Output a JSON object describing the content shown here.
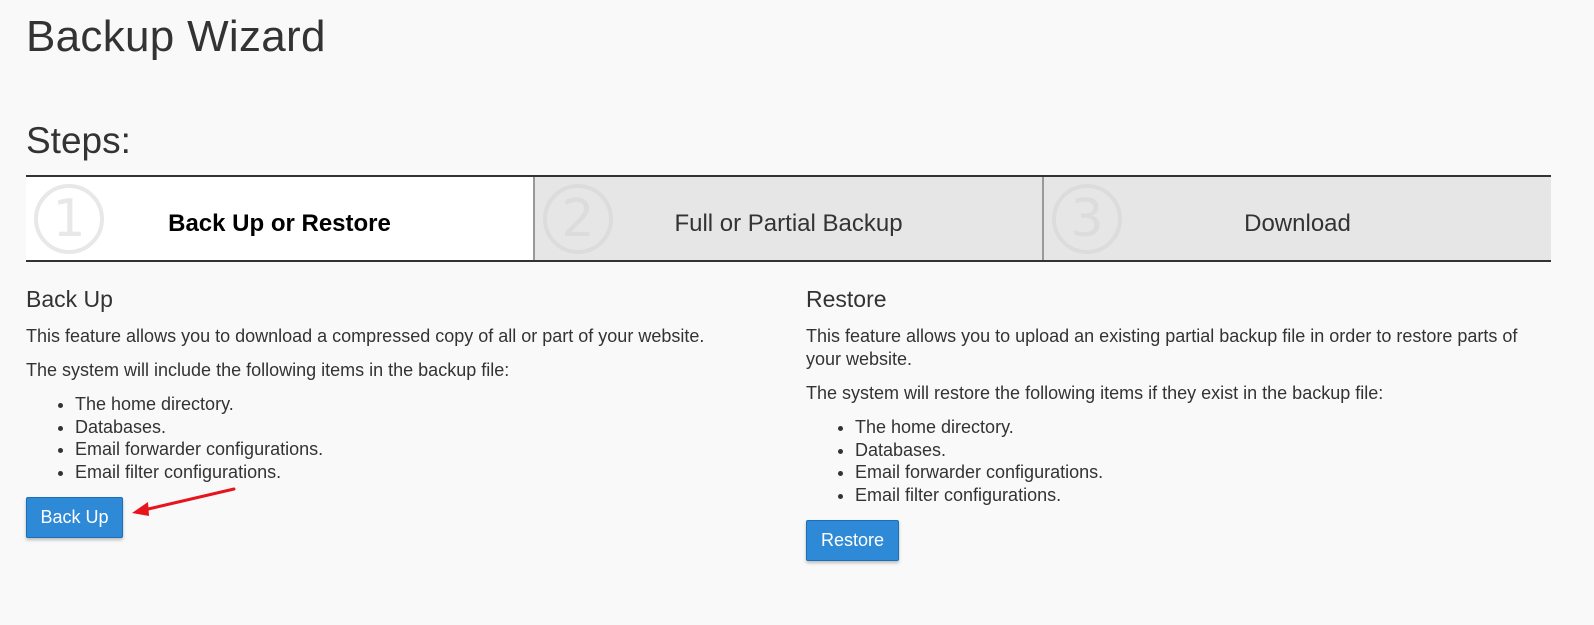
{
  "title": "Backup Wizard",
  "steps_heading": "Steps:",
  "steps": [
    {
      "number": "1",
      "label": "Back Up or Restore",
      "active": true
    },
    {
      "number": "2",
      "label": "Full or Partial Backup",
      "active": false
    },
    {
      "number": "3",
      "label": "Download",
      "active": false
    }
  ],
  "backup": {
    "heading": "Back Up",
    "description": "This feature allows you to download a compressed copy of all or part of your website.",
    "items_intro": "The system will include the following items in the backup file:",
    "items": [
      "The home directory.",
      "Databases.",
      "Email forwarder configurations.",
      "Email filter configurations."
    ],
    "button_label": "Back Up"
  },
  "restore": {
    "heading": "Restore",
    "description": "This feature allows you to upload an existing partial backup file in order to restore parts of your website.",
    "items_intro": "The system will restore the following items if they exist in the backup file:",
    "items": [
      "The home directory.",
      "Databases.",
      "Email forwarder configurations.",
      "Email filter configurations."
    ],
    "button_label": "Restore"
  },
  "colors": {
    "primary_button": "#2e8ad6",
    "annotation_arrow": "#e8141c",
    "background": "#f9f9f9",
    "active_step": "#ffffff",
    "inactive_step": "#e6e6e6"
  }
}
